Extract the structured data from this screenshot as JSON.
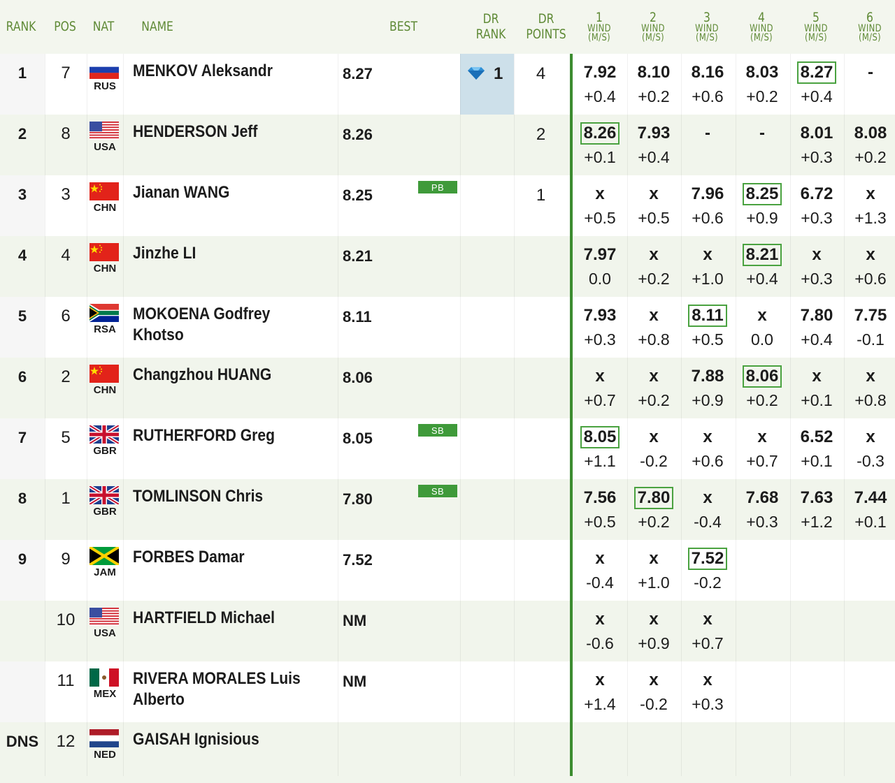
{
  "headers": {
    "rank": "RANK",
    "pos": "POS",
    "nat": "NAT",
    "name": "NAME",
    "best": "BEST",
    "dr_rank_1": "DR",
    "dr_rank_2": "RANK",
    "dr_points_1": "DR",
    "dr_points_2": "POINTS",
    "wind_1": "WIND",
    "wind_2": "(M/S)",
    "round_numbers": [
      "1",
      "2",
      "3",
      "4",
      "5",
      "6"
    ]
  },
  "rows": [
    {
      "rank": "1",
      "pos": "7",
      "nat": "RUS",
      "flag": "rus",
      "name1": "MENKOV Aleksandr",
      "name2": "",
      "best": "8.27",
      "badge": "",
      "dr_rank": "1",
      "dr_rank_highlight": true,
      "dr_points": "4",
      "attempts": [
        {
          "mark": "7.92",
          "wind": "+0.4"
        },
        {
          "mark": "8.10",
          "wind": "+0.2"
        },
        {
          "mark": "8.16",
          "wind": "+0.6"
        },
        {
          "mark": "8.03",
          "wind": "+0.2"
        },
        {
          "mark": "8.27",
          "wind": "+0.4",
          "best": true
        },
        {
          "mark": "-",
          "wind": ""
        }
      ]
    },
    {
      "rank": "2",
      "pos": "8",
      "nat": "USA",
      "flag": "usa",
      "name1": "HENDERSON Jeff",
      "name2": "",
      "best": "8.26",
      "badge": "",
      "dr_rank": "",
      "dr_points": "2",
      "attempts": [
        {
          "mark": "8.26",
          "wind": "+0.1",
          "best": true
        },
        {
          "mark": "7.93",
          "wind": "+0.4"
        },
        {
          "mark": "-",
          "wind": ""
        },
        {
          "mark": "-",
          "wind": ""
        },
        {
          "mark": "8.01",
          "wind": "+0.3"
        },
        {
          "mark": "8.08",
          "wind": "+0.2"
        }
      ]
    },
    {
      "rank": "3",
      "pos": "3",
      "nat": "CHN",
      "flag": "chn",
      "name1": "Jianan WANG",
      "name2": "",
      "best": "8.25",
      "badge": "PB",
      "dr_rank": "",
      "dr_points": "1",
      "attempts": [
        {
          "mark": "x",
          "wind": "+0.5"
        },
        {
          "mark": "x",
          "wind": "+0.5"
        },
        {
          "mark": "7.96",
          "wind": "+0.6"
        },
        {
          "mark": "8.25",
          "wind": "+0.9",
          "best": true
        },
        {
          "mark": "6.72",
          "wind": "+0.3"
        },
        {
          "mark": "x",
          "wind": "+1.3"
        }
      ]
    },
    {
      "rank": "4",
      "pos": "4",
      "nat": "CHN",
      "flag": "chn",
      "name1": "Jinzhe LI",
      "name2": "",
      "best": "8.21",
      "badge": "",
      "dr_rank": "",
      "dr_points": "",
      "attempts": [
        {
          "mark": "7.97",
          "wind": "0.0"
        },
        {
          "mark": "x",
          "wind": "+0.2"
        },
        {
          "mark": "x",
          "wind": "+1.0"
        },
        {
          "mark": "8.21",
          "wind": "+0.4",
          "best": true
        },
        {
          "mark": "x",
          "wind": "+0.3"
        },
        {
          "mark": "x",
          "wind": "+0.6"
        }
      ]
    },
    {
      "rank": "5",
      "pos": "6",
      "nat": "RSA",
      "flag": "rsa",
      "name1": "MOKOENA Godfrey",
      "name2": "Khotso",
      "best": "8.11",
      "badge": "",
      "dr_rank": "",
      "dr_points": "",
      "attempts": [
        {
          "mark": "7.93",
          "wind": "+0.3"
        },
        {
          "mark": "x",
          "wind": "+0.8"
        },
        {
          "mark": "8.11",
          "wind": "+0.5",
          "best": true
        },
        {
          "mark": "x",
          "wind": "0.0"
        },
        {
          "mark": "7.80",
          "wind": "+0.4"
        },
        {
          "mark": "7.75",
          "wind": "-0.1"
        }
      ]
    },
    {
      "rank": "6",
      "pos": "2",
      "nat": "CHN",
      "flag": "chn",
      "name1": "Changzhou HUANG",
      "name2": "",
      "best": "8.06",
      "badge": "",
      "dr_rank": "",
      "dr_points": "",
      "attempts": [
        {
          "mark": "x",
          "wind": "+0.7"
        },
        {
          "mark": "x",
          "wind": "+0.2"
        },
        {
          "mark": "7.88",
          "wind": "+0.9"
        },
        {
          "mark": "8.06",
          "wind": "+0.2",
          "best": true
        },
        {
          "mark": "x",
          "wind": "+0.1"
        },
        {
          "mark": "x",
          "wind": "+0.8"
        }
      ]
    },
    {
      "rank": "7",
      "pos": "5",
      "nat": "GBR",
      "flag": "gbr",
      "name1": "RUTHERFORD Greg",
      "name2": "",
      "best": "8.05",
      "badge": "SB",
      "dr_rank": "",
      "dr_points": "",
      "attempts": [
        {
          "mark": "8.05",
          "wind": "+1.1",
          "best": true
        },
        {
          "mark": "x",
          "wind": "-0.2"
        },
        {
          "mark": "x",
          "wind": "+0.6"
        },
        {
          "mark": "x",
          "wind": "+0.7"
        },
        {
          "mark": "6.52",
          "wind": "+0.1"
        },
        {
          "mark": "x",
          "wind": "-0.3"
        }
      ]
    },
    {
      "rank": "8",
      "pos": "1",
      "nat": "GBR",
      "flag": "gbr",
      "name1": "TOMLINSON Chris",
      "name2": "",
      "best": "7.80",
      "badge": "SB",
      "dr_rank": "",
      "dr_points": "",
      "attempts": [
        {
          "mark": "7.56",
          "wind": "+0.5"
        },
        {
          "mark": "7.80",
          "wind": "+0.2",
          "best": true
        },
        {
          "mark": "x",
          "wind": "-0.4"
        },
        {
          "mark": "7.68",
          "wind": "+0.3"
        },
        {
          "mark": "7.63",
          "wind": "+1.2"
        },
        {
          "mark": "7.44",
          "wind": "+0.1"
        }
      ]
    },
    {
      "rank": "9",
      "pos": "9",
      "nat": "JAM",
      "flag": "jam",
      "name1": "FORBES Damar",
      "name2": "",
      "best": "7.52",
      "badge": "",
      "dr_rank": "",
      "dr_points": "",
      "attempts": [
        {
          "mark": "x",
          "wind": "-0.4"
        },
        {
          "mark": "x",
          "wind": "+1.0"
        },
        {
          "mark": "7.52",
          "wind": "-0.2",
          "best": true
        }
      ]
    },
    {
      "rank": "",
      "pos": "10",
      "nat": "USA",
      "flag": "usa",
      "name1": "HARTFIELD Michael",
      "name2": "",
      "best": "NM",
      "badge": "",
      "dr_rank": "",
      "dr_points": "",
      "attempts": [
        {
          "mark": "x",
          "wind": "-0.6"
        },
        {
          "mark": "x",
          "wind": "+0.9"
        },
        {
          "mark": "x",
          "wind": "+0.7"
        }
      ]
    },
    {
      "rank": "",
      "pos": "11",
      "nat": "MEX",
      "flag": "mex",
      "name1": "RIVERA MORALES Luis",
      "name2": "Alberto",
      "best": "NM",
      "badge": "",
      "dr_rank": "",
      "dr_points": "",
      "attempts": [
        {
          "mark": "x",
          "wind": "+1.4"
        },
        {
          "mark": "x",
          "wind": "-0.2"
        },
        {
          "mark": "x",
          "wind": "+0.3"
        }
      ]
    },
    {
      "rank": "DNS",
      "pos": "12",
      "nat": "NED",
      "flag": "ned",
      "name1": "GAISAH Ignisious",
      "name2": "",
      "best": "",
      "badge": "",
      "dr_rank": "",
      "dr_points": "",
      "attempts": []
    }
  ],
  "colors": {
    "accent": "#5f8a36",
    "best_box": "#4aa240",
    "badge": "#3f9a3a",
    "row_alt": "#f1f5ec",
    "dr_highlight": "#cde0ea"
  }
}
